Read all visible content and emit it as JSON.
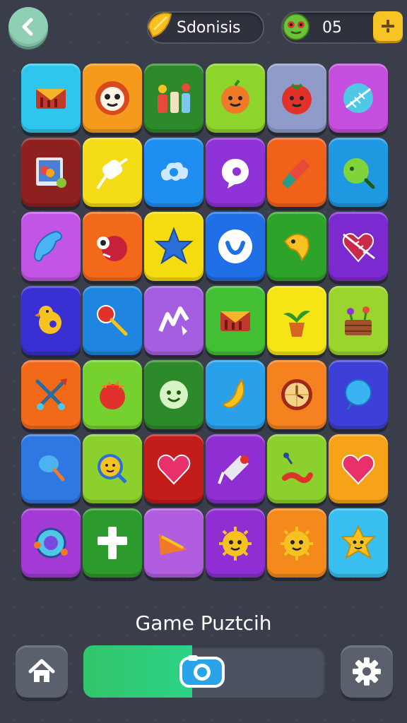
{
  "header": {
    "player_name": "Sdonisis",
    "score": "05",
    "name_icon": "banana-badge-icon",
    "score_icon": "green-monster-icon",
    "plus_icon": "plus-icon",
    "back_icon": "chevron-left-icon"
  },
  "board": {
    "tiles": [
      {
        "color": "#2fc6ee",
        "icon": "envelope-icon"
      },
      {
        "color": "#f59a1c",
        "icon": "lion-face-icon"
      },
      {
        "color": "#2c8a2a",
        "icon": "candy-jars-icon"
      },
      {
        "color": "#8dd42c",
        "icon": "orange-face-icon"
      },
      {
        "color": "#8f9cc9",
        "icon": "tomato-face-icon"
      },
      {
        "color": "#c64fe0",
        "icon": "leaf-ball-icon"
      },
      {
        "color": "#8f2020",
        "icon": "photo-icon"
      },
      {
        "color": "#f4dc16",
        "icon": "marshmallow-stick-icon"
      },
      {
        "color": "#1e8ff0",
        "icon": "cloud-icon"
      },
      {
        "color": "#8f33d9",
        "icon": "chat-bubble-icon"
      },
      {
        "color": "#f0611a",
        "icon": "paintbrush-icon"
      },
      {
        "color": "#1e98e0",
        "icon": "green-ball-icon"
      },
      {
        "color": "#c355e6",
        "icon": "phone-handset-icon"
      },
      {
        "color": "#f26a19",
        "icon": "monster-icon"
      },
      {
        "color": "#f5dc10",
        "icon": "star-icon"
      },
      {
        "color": "#1f6fe6",
        "icon": "heart-badge-icon"
      },
      {
        "color": "#2ea32a",
        "icon": "fish-icon"
      },
      {
        "color": "#7c2ad0",
        "icon": "arrow-heart-icon"
      },
      {
        "color": "#3a2fd2",
        "icon": "duck-icon"
      },
      {
        "color": "#1e85e0",
        "icon": "lollipop-icon"
      },
      {
        "color": "#a45ee0",
        "icon": "peaks-icon"
      },
      {
        "color": "#43bf34",
        "icon": "envelope-icon"
      },
      {
        "color": "#f6e515",
        "icon": "potted-plant-icon"
      },
      {
        "color": "#9ad42c",
        "icon": "flower-basket-icon"
      },
      {
        "color": "#f26a19",
        "icon": "crossed-swords-icon"
      },
      {
        "color": "#75d22e",
        "icon": "red-berry-icon"
      },
      {
        "color": "#2c8a2a",
        "icon": "smiley-face-icon"
      },
      {
        "color": "#28a0ea",
        "icon": "banana-icon"
      },
      {
        "color": "#f5821e",
        "icon": "clock-icon"
      },
      {
        "color": "#3d3fd8",
        "icon": "balloon-icon"
      },
      {
        "color": "#2f78e4",
        "icon": "ice-pop-icon"
      },
      {
        "color": "#8bd02c",
        "icon": "mirror-face-icon"
      },
      {
        "color": "#c41b1b",
        "icon": "heart-icon"
      },
      {
        "color": "#8e2ed3",
        "icon": "bell-icon"
      },
      {
        "color": "#8bd02c",
        "icon": "worm-icon"
      },
      {
        "color": "#f6a318",
        "icon": "heart-icon"
      },
      {
        "color": "#a33ad6",
        "icon": "orbit-face-icon"
      },
      {
        "color": "#2c9a2c",
        "icon": "cross-icon"
      },
      {
        "color": "#b05de0",
        "icon": "cheese-icon"
      },
      {
        "color": "#8e2ed3",
        "icon": "sun-face-icon"
      },
      {
        "color": "#f58a1c",
        "icon": "sun-face-icon"
      },
      {
        "color": "#38bff0",
        "icon": "star-face-icon"
      }
    ]
  },
  "footer": {
    "title": "Game Puztcih",
    "progress": 0.45,
    "home_icon": "home-icon",
    "settings_icon": "gear-icon",
    "knob_icon": "camera-icon"
  }
}
